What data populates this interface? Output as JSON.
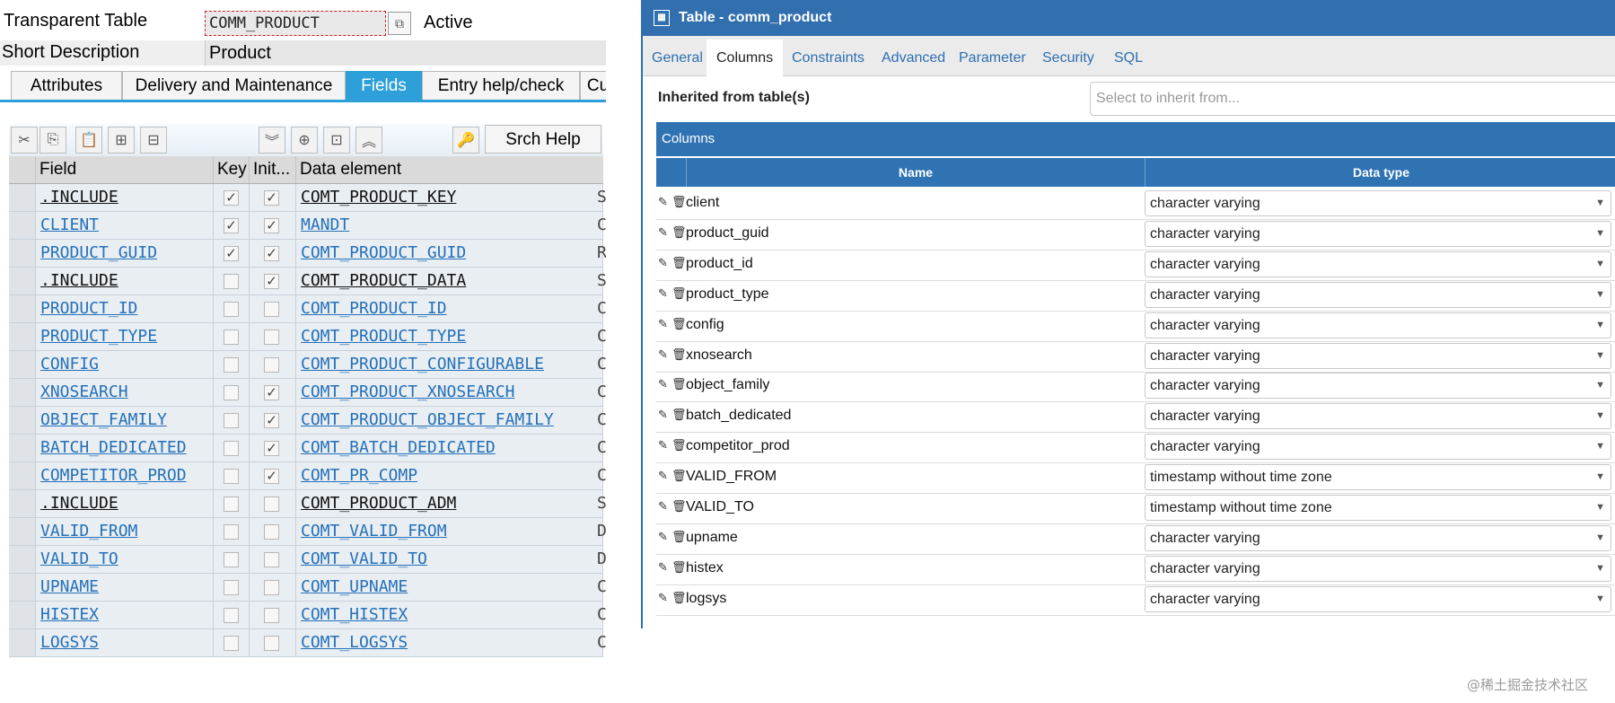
{
  "sap": {
    "transparent_table_label": "Transparent Table",
    "table_name": "COMM_PRODUCT",
    "status": "Active",
    "short_desc_label": "Short Description",
    "short_desc_value": "Product",
    "tabs": [
      "Attributes",
      "Delivery and Maintenance",
      "Fields",
      "Entry help/check",
      "Cu"
    ],
    "active_tab": "Fields",
    "srch_help_button": "Srch Help",
    "toolbar_icons": [
      "cut-icon",
      "copy-icon",
      "paste-icon",
      "insert-row-icon",
      "delete-row-icon",
      "expand-all-icon",
      "insert-include-icon",
      "expand-include-icon",
      "collapse-all-icon",
      "key-icon"
    ],
    "columns": [
      "Field",
      "Key",
      "Init...",
      "Data element"
    ],
    "rows": [
      {
        "field": ".INCLUDE",
        "key": true,
        "init": true,
        "element": "COMT_PRODUCT_KEY",
        "link": false,
        "suffix": "S"
      },
      {
        "field": "CLIENT",
        "key": true,
        "init": true,
        "element": "MANDT",
        "link": true,
        "suffix": "C"
      },
      {
        "field": "PRODUCT_GUID",
        "key": true,
        "init": true,
        "element": "COMT_PRODUCT_GUID",
        "link": true,
        "suffix": "R"
      },
      {
        "field": ".INCLUDE",
        "key": false,
        "init": true,
        "element": "COMT_PRODUCT_DATA",
        "link": false,
        "suffix": "S"
      },
      {
        "field": "PRODUCT_ID",
        "key": false,
        "init": false,
        "element": "COMT_PRODUCT_ID",
        "link": true,
        "suffix": "C"
      },
      {
        "field": "PRODUCT_TYPE",
        "key": false,
        "init": false,
        "element": "COMT_PRODUCT_TYPE",
        "link": true,
        "suffix": "C"
      },
      {
        "field": "CONFIG",
        "key": false,
        "init": false,
        "element": "COMT_PRODUCT_CONFIGURABLE",
        "link": true,
        "suffix": "C"
      },
      {
        "field": "XNOSEARCH",
        "key": false,
        "init": true,
        "element": "COMT_PRODUCT_XNOSEARCH",
        "link": true,
        "suffix": "C"
      },
      {
        "field": "OBJECT_FAMILY",
        "key": false,
        "init": true,
        "element": "COMT_PRODUCT_OBJECT_FAMILY",
        "link": true,
        "suffix": "C"
      },
      {
        "field": "BATCH_DEDICATED",
        "key": false,
        "init": true,
        "element": "COMT_BATCH_DEDICATED",
        "link": true,
        "suffix": "C"
      },
      {
        "field": "COMPETITOR_PROD",
        "key": false,
        "init": true,
        "element": "COMT_PR_COMP",
        "link": true,
        "suffix": "C"
      },
      {
        "field": ".INCLUDE",
        "key": false,
        "init": false,
        "element": "COMT_PRODUCT_ADM",
        "link": false,
        "suffix": "S"
      },
      {
        "field": "VALID_FROM",
        "key": false,
        "init": false,
        "element": "COMT_VALID_FROM",
        "link": true,
        "suffix": "D"
      },
      {
        "field": "VALID_TO",
        "key": false,
        "init": false,
        "element": "COMT_VALID_TO",
        "link": true,
        "suffix": "D"
      },
      {
        "field": "UPNAME",
        "key": false,
        "init": false,
        "element": "COMT_UPNAME",
        "link": true,
        "suffix": "C"
      },
      {
        "field": "HISTEX",
        "key": false,
        "init": false,
        "element": "COMT_HISTEX",
        "link": true,
        "suffix": "C"
      },
      {
        "field": "LOGSYS",
        "key": false,
        "init": false,
        "element": "COMT_LOGSYS",
        "link": true,
        "suffix": "C"
      }
    ]
  },
  "pg": {
    "title": "Table - comm_product",
    "tabs": [
      "General",
      "Columns",
      "Constraints",
      "Advanced",
      "Parameter",
      "Security",
      "SQL"
    ],
    "active_tab": "Columns",
    "inherited_label": "Inherited from table(s)",
    "inherit_placeholder": "Select to inherit from...",
    "columns_band": "Columns",
    "headers": {
      "name": "Name",
      "type": "Data type"
    },
    "rows": [
      {
        "name": "client",
        "type": "character varying"
      },
      {
        "name": "product_guid",
        "type": "character varying"
      },
      {
        "name": "product_id",
        "type": "character varying"
      },
      {
        "name": "product_type",
        "type": "character varying"
      },
      {
        "name": "config",
        "type": "character varying"
      },
      {
        "name": "xnosearch",
        "type": "character varying"
      },
      {
        "name": "object_family",
        "type": "character varying"
      },
      {
        "name": "batch_dedicated",
        "type": "character varying"
      },
      {
        "name": "competitor_prod",
        "type": "character varying"
      },
      {
        "name": "VALID_FROM",
        "type": "timestamp without time zone"
      },
      {
        "name": "VALID_TO",
        "type": "timestamp without time zone"
      },
      {
        "name": "upname",
        "type": "character varying"
      },
      {
        "name": "histex",
        "type": "character varying"
      },
      {
        "name": "logsys",
        "type": "character varying"
      }
    ]
  },
  "watermark": "@稀土掘金技术社区"
}
